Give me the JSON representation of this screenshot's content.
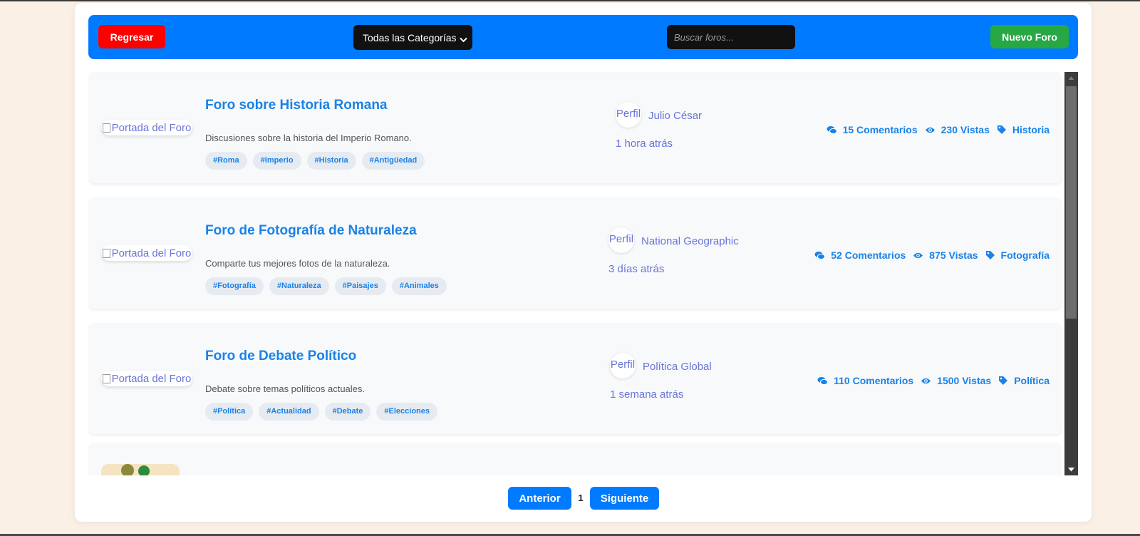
{
  "toolbar": {
    "back_label": "Regresar",
    "category_selected": "Todas las Categorías",
    "search_placeholder": "Buscar foros...",
    "new_label": "Nuevo Foro"
  },
  "forums": [
    {
      "cover_alt": "Portada del Foro",
      "title": "Foro sobre Historia Romana",
      "description": "Discusiones sobre la historia del Imperio Romano.",
      "tags": [
        "#Roma",
        "#Imperio",
        "#Historia",
        "#Antigüedad"
      ],
      "avatar_alt": "Perfil",
      "author": "Julio César",
      "time": "1 hora atrás",
      "comments": "15 Comentarios",
      "views": "230 Vistas",
      "category": "Historia"
    },
    {
      "cover_alt": "Portada del Foro",
      "title": "Foro de Fotografía de Naturaleza",
      "description": "Comparte tus mejores fotos de la naturaleza.",
      "tags": [
        "#Fotografía",
        "#Naturaleza",
        "#Paisajes",
        "#Animales"
      ],
      "avatar_alt": "Perfil",
      "author": "National Geographic",
      "time": "3 días atrás",
      "comments": "52 Comentarios",
      "views": "875 Vistas",
      "category": "Fotografía"
    },
    {
      "cover_alt": "Portada del Foro",
      "title": "Foro de Debate Político",
      "description": "Debate sobre temas políticos actuales.",
      "tags": [
        "#Política",
        "#Actualidad",
        "#Debate",
        "#Elecciones"
      ],
      "avatar_alt": "Perfil",
      "author": "Política Global",
      "time": "1 semana atrás",
      "comments": "110 Comentarios",
      "views": "1500 Vistas",
      "category": "Política"
    }
  ],
  "pagination": {
    "prev_label": "Anterior",
    "current_page": "1",
    "next_label": "Siguiente"
  },
  "colors": {
    "page_bg": "#faf0e6",
    "toolbar": "#007bff",
    "back_button": "#ff0000",
    "new_button": "#28a745",
    "link_blue": "#1a82e8",
    "author_purple": "#6a74d8"
  },
  "icons": {
    "comments": "comments-icon",
    "views": "eye-icon",
    "category": "tag-icon",
    "select": "chevron-down-icon"
  }
}
